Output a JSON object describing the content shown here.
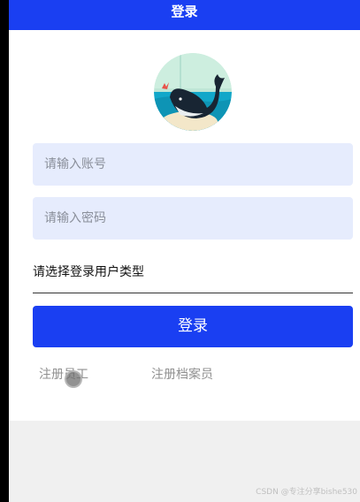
{
  "header": {
    "title": "登录"
  },
  "form": {
    "account_placeholder": "请输入账号",
    "password_placeholder": "请输入密码",
    "user_type_label": "请选择登录用户类型",
    "login_button_label": "登录"
  },
  "links": {
    "register_employee": "注册员工",
    "register_archivist": "注册档案员"
  },
  "watermark": "CSDN @专注分享bishe530",
  "colors": {
    "primary": "#1a3ff2",
    "input_bg": "#e6ecfd",
    "page_bg": "#f0f0f0"
  },
  "icons": {
    "avatar": "whale-logo"
  }
}
